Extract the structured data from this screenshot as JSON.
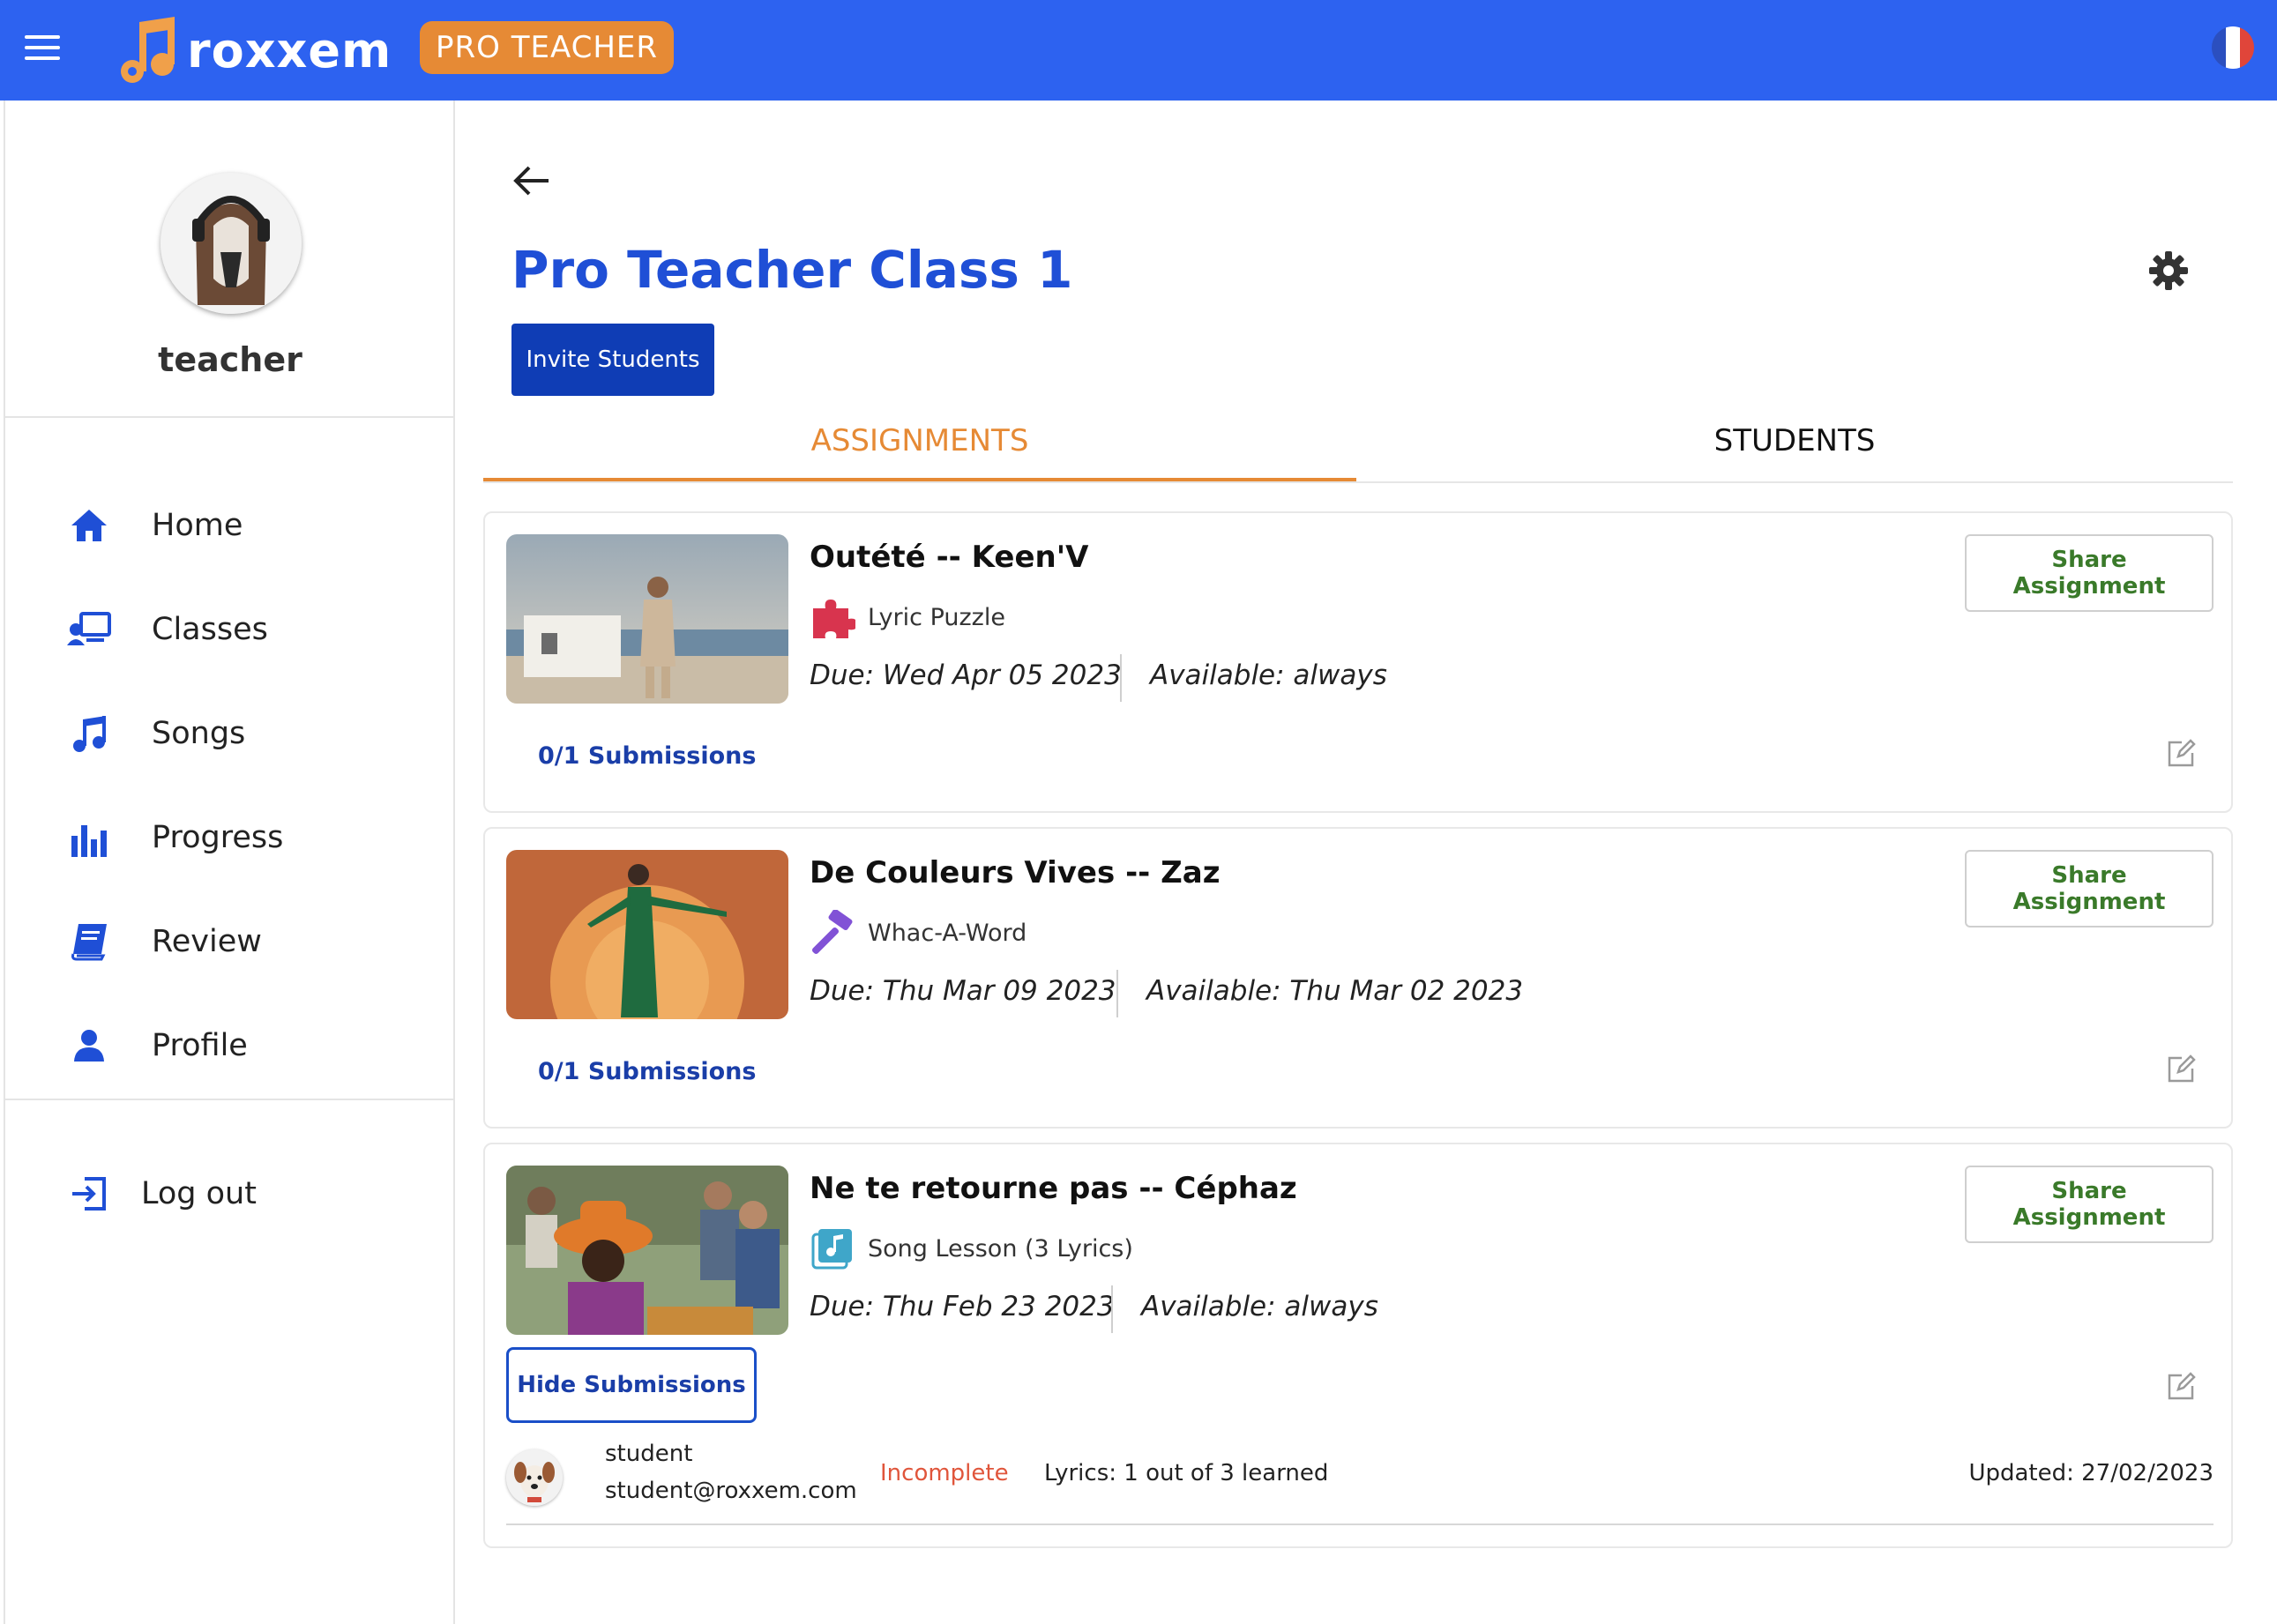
{
  "header": {
    "app_name": "roxxem",
    "badge": "PRO TEACHER",
    "colors": {
      "bar": "#2d62f0",
      "badge": "#e68a35"
    }
  },
  "sidebar": {
    "username": "teacher",
    "items": [
      {
        "label": "Home",
        "icon": "home-icon"
      },
      {
        "label": "Classes",
        "icon": "classes-icon"
      },
      {
        "label": "Songs",
        "icon": "music-note-icon"
      },
      {
        "label": "Progress",
        "icon": "bar-chart-icon"
      },
      {
        "label": "Review",
        "icon": "book-icon"
      },
      {
        "label": "Profile",
        "icon": "person-icon"
      }
    ],
    "logout": "Log out"
  },
  "main": {
    "class_title": "Pro Teacher Class 1",
    "invite_label": "Invite Students",
    "tabs": [
      {
        "label": "ASSIGNMENTS",
        "active": true
      },
      {
        "label": "STUDENTS",
        "active": false
      }
    ],
    "assignments": [
      {
        "title": "Outété -- Keen'V",
        "activity": "Lyric Puzzle",
        "activity_icon": "puzzle-icon",
        "due": "Due: Wed Apr 05 2023",
        "available": "Available: always",
        "share_label": "Share Assignment",
        "submissions": "0/1 Submissions"
      },
      {
        "title": "De Couleurs Vives -- Zaz",
        "activity": "Whac-A-Word",
        "activity_icon": "hammer-icon",
        "due": "Due: Thu Mar 09 2023",
        "available": "Available: Thu Mar 02 2023",
        "share_label": "Share Assignment",
        "submissions": "0/1 Submissions"
      },
      {
        "title": "Ne te retourne pas -- Céphaz",
        "activity": "Song Lesson (3 Lyrics)",
        "activity_icon": "song-lesson-icon",
        "due": "Due: Thu Feb 23 2023",
        "available": "Available: always",
        "share_label": "Share Assignment",
        "hide_label": "Hide Submissions",
        "submission_rows": [
          {
            "name": "student",
            "email": "student@roxxem.com",
            "status": "Incomplete",
            "lyrics": "Lyrics: 1 out of 3 learned",
            "updated": "Updated: 27/02/2023"
          }
        ]
      }
    ]
  }
}
